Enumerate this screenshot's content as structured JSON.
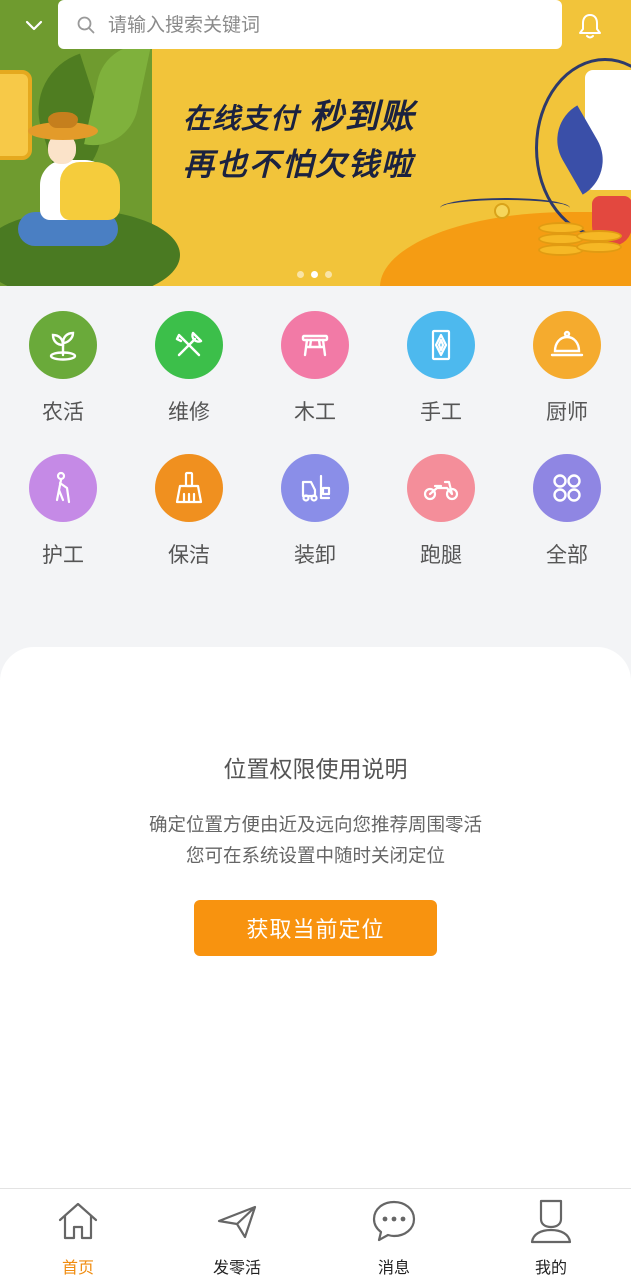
{
  "search": {
    "placeholder": "请输入搜索关键词"
  },
  "banner": {
    "line1_a": "在线支付",
    "line1_b": "秒到账",
    "line2": "再也不怕欠钱啦",
    "page_indicator": {
      "count": 3,
      "active": 2
    }
  },
  "categories": [
    {
      "label": "农活",
      "icon": "sprout-icon",
      "color": "#6aaa3a"
    },
    {
      "label": "维修",
      "icon": "tools-icon",
      "color": "#3cbf4a"
    },
    {
      "label": "木工",
      "icon": "bench-icon",
      "color": "#f27aa6"
    },
    {
      "label": "手工",
      "icon": "craft-icon",
      "color": "#4db9ee"
    },
    {
      "label": "厨师",
      "icon": "cloche-icon",
      "color": "#f5ab2e"
    },
    {
      "label": "护工",
      "icon": "elderly-icon",
      "color": "#c58ae6"
    },
    {
      "label": "保洁",
      "icon": "broom-icon",
      "color": "#f0901f"
    },
    {
      "label": "装卸",
      "icon": "forklift-icon",
      "color": "#8a8ee8"
    },
    {
      "label": "跑腿",
      "icon": "motorbike-icon",
      "color": "#f48e9a"
    },
    {
      "label": "全部",
      "icon": "grid-icon",
      "color": "#8f86e3"
    }
  ],
  "location": {
    "title": "位置权限使用说明",
    "desc_line1": "确定位置方便由近及远向您推荐周围零活",
    "desc_line2": "您可在系统设置中随时关闭定位",
    "button_label": "获取当前定位"
  },
  "nav": [
    {
      "label": "首页",
      "icon": "home-icon",
      "active": true
    },
    {
      "label": "发零活",
      "icon": "send-icon",
      "active": false
    },
    {
      "label": "消息",
      "icon": "message-icon",
      "active": false
    },
    {
      "label": "我的",
      "icon": "user-icon",
      "active": false
    }
  ],
  "colors": {
    "accent": "#f8930f",
    "banner_yellow": "#f2c43a",
    "nav_active": "#f08c10"
  }
}
